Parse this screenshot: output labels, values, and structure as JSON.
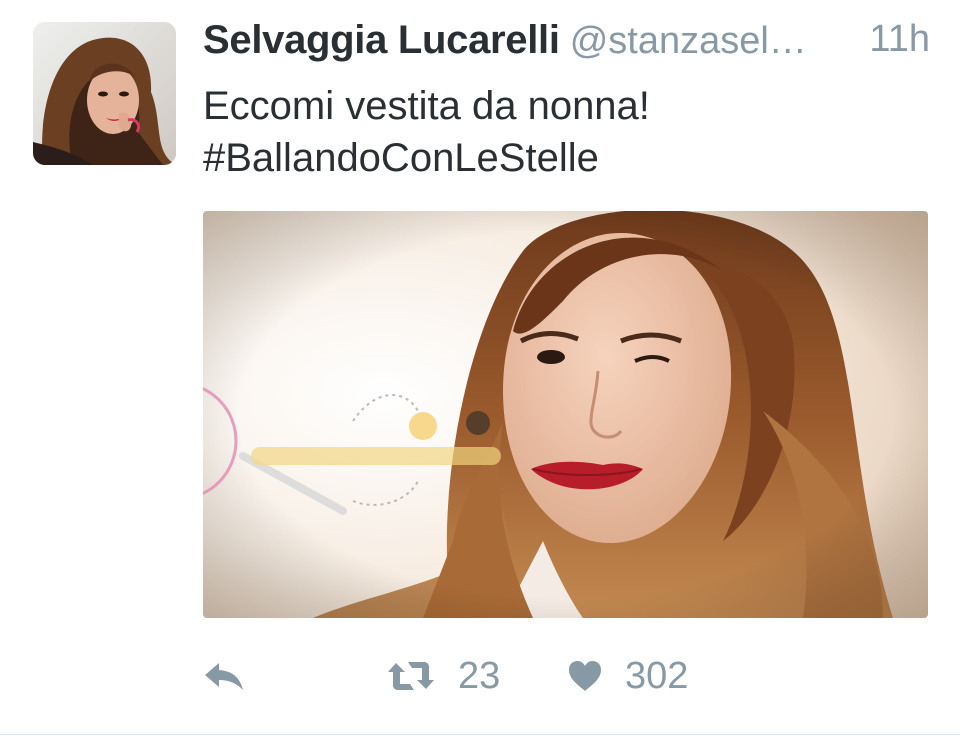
{
  "tweet": {
    "display_name": "Selvaggia Lucarelli",
    "handle": "@stanzasel…",
    "time": "11h",
    "text_line_1": "Eccomi vestita da nonna!",
    "text_line_2": "#BallandoConLeStelle"
  },
  "actions": {
    "reply_icon": "reply-icon",
    "retweet_icon": "retweet-icon",
    "retweet_count": "23",
    "like_icon": "heart-icon",
    "like_count": "302"
  },
  "colors": {
    "text_primary": "#292f33",
    "text_secondary": "#8899a6",
    "lipstick": "#b81e2a"
  }
}
